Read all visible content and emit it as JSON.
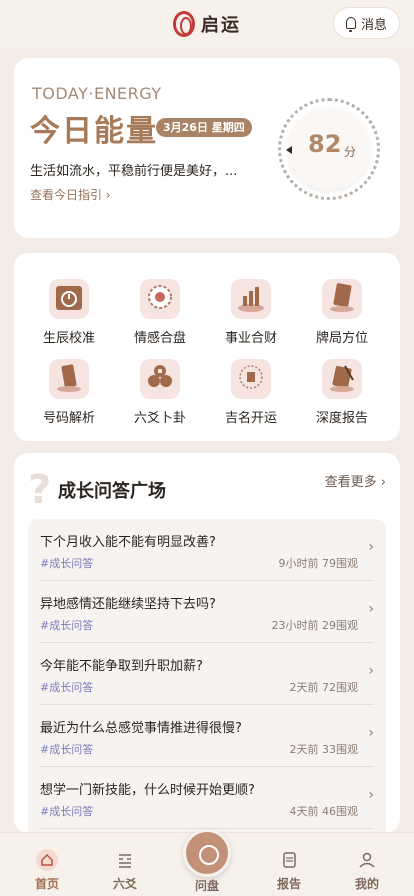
{
  "header": {
    "brand": "启运",
    "message_label": "消息"
  },
  "energy": {
    "title_en": "TODAY·ENERGY",
    "title": "今日能量",
    "date": "3月26日 星期四",
    "text": "生活如流水，平稳前行便是美好，...",
    "link": "查看今日指引 ›",
    "score": "82",
    "unit": "分"
  },
  "tools": [
    {
      "label": "生辰校准",
      "icon": "calendar-icon"
    },
    {
      "label": "情感合盘",
      "icon": "love-chart-icon"
    },
    {
      "label": "事业合财",
      "icon": "career-icon"
    },
    {
      "label": "牌局方位",
      "icon": "cards-icon"
    },
    {
      "label": "号码解析",
      "icon": "phone-icon"
    },
    {
      "label": "六爻卜卦",
      "icon": "coins-icon"
    },
    {
      "label": "吉名开运",
      "icon": "name-icon"
    },
    {
      "label": "深度报告",
      "icon": "report-icon"
    }
  ],
  "qa": {
    "title": "成长问答广场",
    "more": "查看更多 ›",
    "items": [
      {
        "q": "下个月收入能不能有明显改善?",
        "tag": "#成长问答",
        "time": "9小时前",
        "views": "79围观"
      },
      {
        "q": "异地感情还能继续坚持下去吗?",
        "tag": "#成长问答",
        "time": "23小时前",
        "views": "29围观"
      },
      {
        "q": "今年能不能争取到升职加薪?",
        "tag": "#成长问答",
        "time": "2天前",
        "views": "72围观"
      },
      {
        "q": "最近为什么总感觉事情推进得很慢?",
        "tag": "#成长问答",
        "time": "2天前",
        "views": "33围观"
      },
      {
        "q": "想学一门新技能，什么时候开始更顺?",
        "tag": "#成长问答",
        "time": "4天前",
        "views": "46围观"
      }
    ]
  },
  "tabbar": {
    "home": "首页",
    "liuyao": "六爻",
    "wenpan": "问盘",
    "report": "报告",
    "mine": "我的"
  },
  "colors": {
    "accent": "#a77a5a",
    "tag": "#7e7cbf",
    "brand_red": "#c33a3a"
  }
}
